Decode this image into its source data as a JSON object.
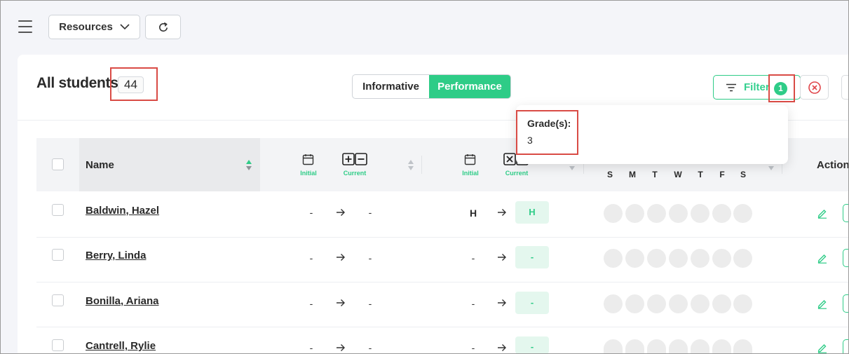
{
  "toolbar": {
    "menu_icon": "hamburger-menu-icon",
    "resources_label": "Resources",
    "resources_icon": "chevron-down-icon",
    "refresh_icon": "refresh-icon"
  },
  "header": {
    "title": "All students",
    "count": "44"
  },
  "view_toggle": {
    "options": [
      "Informative",
      "Performance"
    ],
    "selected": "Performance"
  },
  "filter": {
    "label": "Filter",
    "active_count": "1",
    "clear_icon": "close-circle-icon"
  },
  "filter_popover": {
    "label": "Grade(s):",
    "value": "3"
  },
  "table": {
    "columns": {
      "name": "Name",
      "attendance_initial": "Initial",
      "attendance_current": "Current",
      "behavior_initial": "Initial",
      "behavior_current": "Current",
      "days": [
        "S",
        "M",
        "T",
        "W",
        "T",
        "F",
        "S"
      ],
      "actions": "Actions"
    },
    "rows": [
      {
        "name": "Baldwin, Hazel",
        "a_initial": "-",
        "a_current": "-",
        "b_initial": "H",
        "b_current": "H"
      },
      {
        "name": "Berry, Linda",
        "a_initial": "-",
        "a_current": "-",
        "b_initial": "-",
        "b_current": "-"
      },
      {
        "name": "Bonilla, Ariana",
        "a_initial": "-",
        "a_current": "-",
        "b_initial": "-",
        "b_current": "-"
      },
      {
        "name": "Cantrell, Rylie",
        "a_initial": "-",
        "a_current": "-",
        "b_initial": "-",
        "b_current": "-"
      }
    ]
  },
  "colors": {
    "accent": "#2ecc87",
    "highlight": "#d94b45",
    "danger": "#e0454a"
  }
}
